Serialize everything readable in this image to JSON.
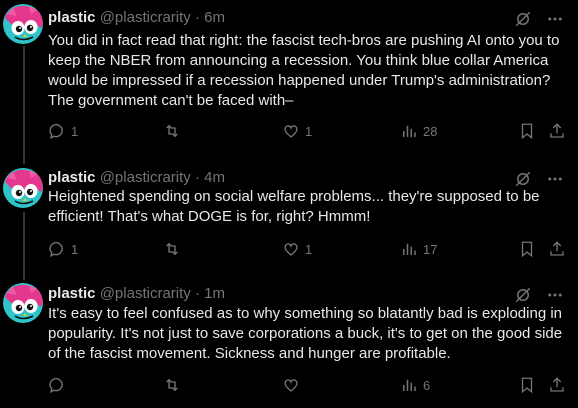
{
  "posts": [
    {
      "display_name": "plastic",
      "handle": "@plasticrarity",
      "separator": "·",
      "time": "6m",
      "text": "You did in fact read that right: the fascist tech-bros are pushing AI onto you to keep the NBER from announcing a recession. You think blue collar America would be impressed if a recession happened under Trump's administration? The government can't be faced with–",
      "replies": "1",
      "reposts": "",
      "likes": "1",
      "views": "28"
    },
    {
      "display_name": "plastic",
      "handle": "@plasticrarity",
      "separator": "·",
      "time": "4m",
      "text": "Heightened spending on social welfare problems... they're supposed to be efficient! That's what DOGE is for, right? Hmmm!",
      "replies": "1",
      "reposts": "",
      "likes": "1",
      "views": "17"
    },
    {
      "display_name": "plastic",
      "handle": "@plasticrarity",
      "separator": "·",
      "time": "1m",
      "text": "It's easy to feel confused as to why something so blatantly bad is exploding in popularity. It's not just to save corporations a buck, it's to get on the good side of the fascist movement. Sickness and hunger are profitable.",
      "replies": "",
      "reposts": "",
      "likes": "",
      "views": "6"
    }
  ],
  "icons": {
    "grok": "grok-icon",
    "more": "more-icon",
    "reply": "reply-icon",
    "repost": "repost-icon",
    "like": "like-icon",
    "views": "views-icon",
    "bookmark": "bookmark-icon",
    "share": "share-icon"
  },
  "colors": {
    "background": "#000000",
    "text": "#e7e9ea",
    "muted": "#71767b",
    "thread_line": "#333639"
  }
}
